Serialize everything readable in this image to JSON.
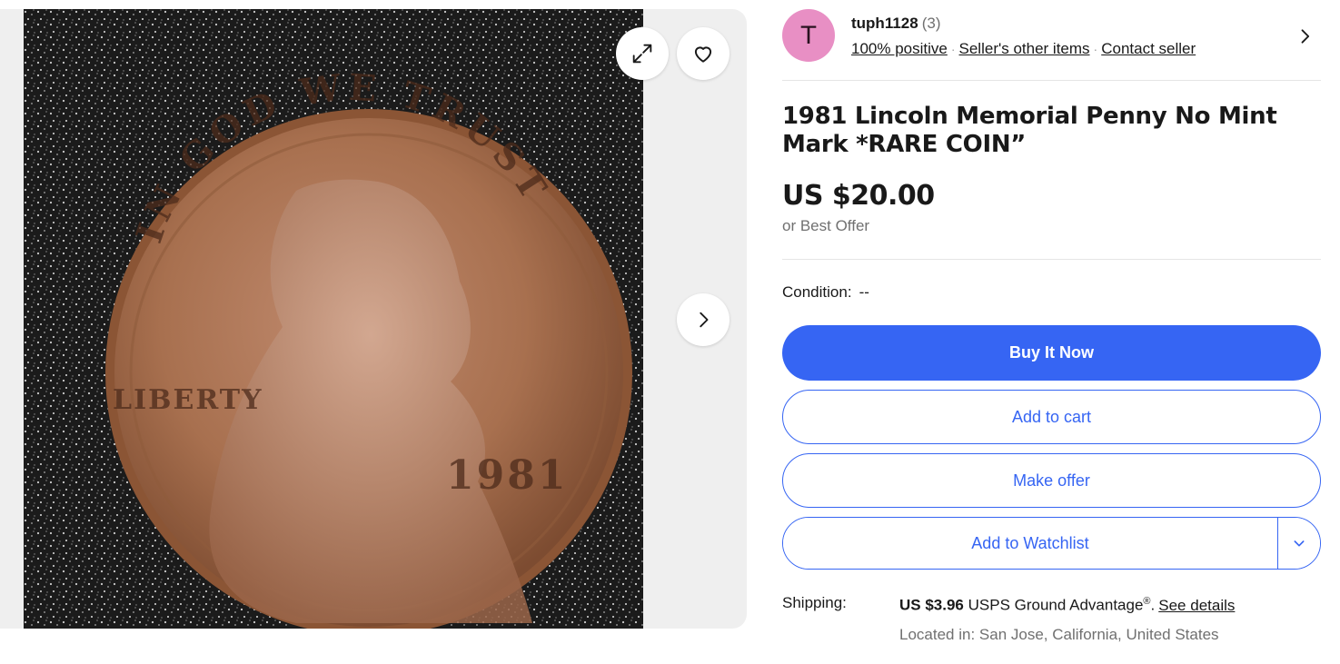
{
  "gallery": {
    "image_alt": "1981 Lincoln Memorial Penny photo",
    "coin_text": {
      "motto": "IN GOD WE TRUST",
      "liberty": "LIBERTY",
      "year": "1981"
    }
  },
  "seller": {
    "avatar_letter": "T",
    "avatar_color": "#e88fc4",
    "name": "tuph1128",
    "feedback_count": "(3)",
    "positive": "100% positive",
    "other_items": "Seller's other items",
    "contact": "Contact seller"
  },
  "listing": {
    "title": "1981 Lincoln Memorial Penny No Mint Mark *RARE COIN”",
    "price": "US $20.00",
    "best_offer": "or Best Offer",
    "condition_label": "Condition:",
    "condition_value": "--"
  },
  "actions": {
    "buy_now": "Buy It Now",
    "add_to_cart": "Add to cart",
    "make_offer": "Make offer",
    "add_to_watchlist": "Add to Watchlist"
  },
  "shipping": {
    "label": "Shipping:",
    "cost": "US $3.96",
    "service": "USPS Ground Advantage",
    "registered": "®",
    "period": ".",
    "details_link": "See details",
    "location": "Located in: San Jose, California, United States"
  },
  "colors": {
    "accent": "#3665f3",
    "text": "#191919",
    "muted": "#707070"
  },
  "icons": [
    "expand-icon",
    "heart-icon",
    "chevron-right-icon",
    "chevron-down-icon"
  ]
}
